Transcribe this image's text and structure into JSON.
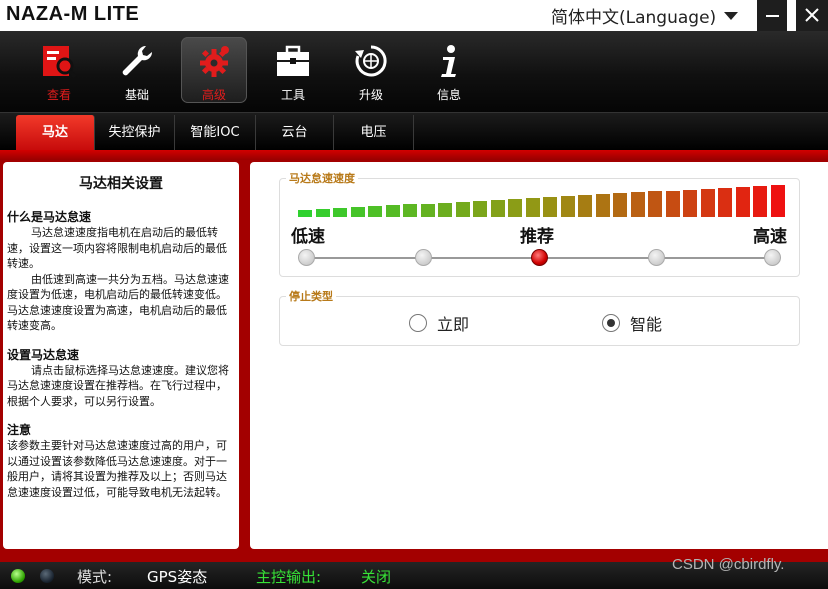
{
  "window": {
    "title": "NAZA-M LITE",
    "language": "简体中文(Language)"
  },
  "toolbar": {
    "items": [
      {
        "label": "查看",
        "icon": "view-search-icon"
      },
      {
        "label": "基础",
        "icon": "wrench-icon"
      },
      {
        "label": "高级",
        "icon": "gear-icon"
      },
      {
        "label": "工具",
        "icon": "toolbox-icon"
      },
      {
        "label": "升级",
        "icon": "upgrade-icon"
      },
      {
        "label": "信息",
        "icon": "info-icon"
      }
    ],
    "active_index": 2
  },
  "subtabs": {
    "items": [
      "马达",
      "失控保护",
      "智能IOC",
      "云台",
      "电压"
    ],
    "active_index": 0
  },
  "help": {
    "title": "马达相关设置",
    "section1_heading": "什么是马达怠速",
    "section1_p1": "马达怠速速度指电机在启动后的最低转速，设置这一项内容将限制电机启动后的最低转速。",
    "section1_p2": "由低速到高速一共分为五档。马达怠速速度设置为低速，电机启动后的最低转速变低。马达怠速速度设置为高速，电机启动后的最低转速变高。",
    "section2_heading": "设置马达怠速",
    "section2_p1": "请点击鼠标选择马达怠速速度。建议您将马达怠速速度设置在推荐档。在飞行过程中，根据个人要求，可以另行设置。",
    "section3_heading": "注意",
    "section3_p1": "该参数主要针对马达怠速速度过高的用户，可以通过设置该参数降低马达怠速速度。对于一般用户，请将其设置为推荐及以上；否则马达怠速速度设置过低，可能导致电机无法起转。"
  },
  "idle_speed": {
    "legend": "马达怠速速度",
    "label_low": "低速",
    "label_recommended": "推荐",
    "label_high": "高速",
    "levels": 5,
    "selected_level": 2,
    "bar_count": 28,
    "bar_color_low": "#2fd12f",
    "bar_color_high": "#ee1111"
  },
  "stop_type": {
    "legend": "停止类型",
    "option_immediate": "立即",
    "option_smart": "智能",
    "selected": "智能"
  },
  "status": {
    "mode_label": "模式:",
    "mode_value": "GPS姿态",
    "output_label": "主控输出:",
    "output_value": "关闭",
    "led_green": "#2ea300",
    "led_blue": "#1a2430"
  },
  "watermark": "CSDN @cbirdfly."
}
